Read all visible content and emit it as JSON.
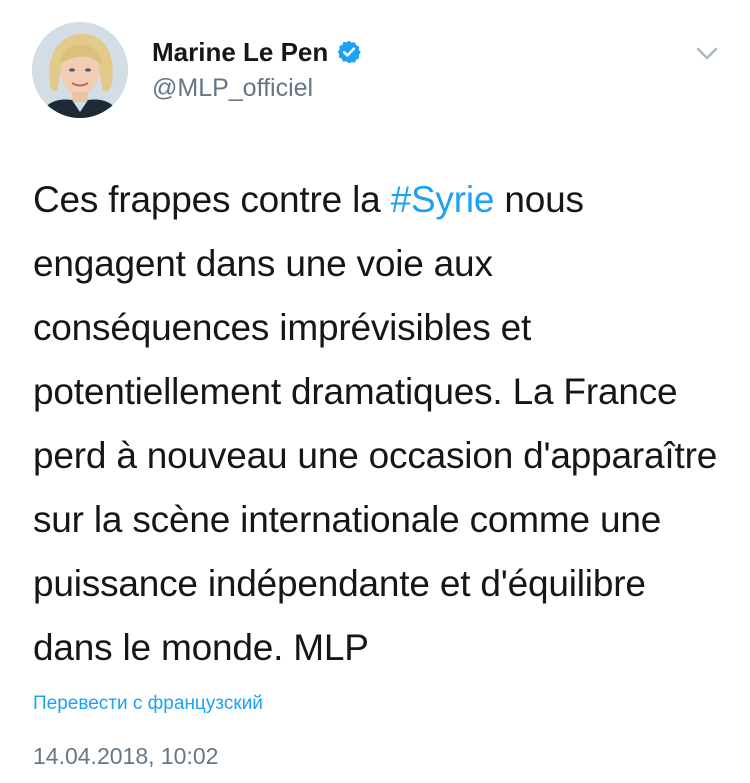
{
  "author": {
    "display_name": "Marine Le Pen",
    "handle": "@MLP_officiel",
    "verified": true
  },
  "icons": {
    "avatar": "profile-photo",
    "verified": "verified-badge-icon",
    "menu": "chevron-down-icon"
  },
  "tweet": {
    "text_before_hashtag": "Ces frappes contre la ",
    "hashtag": "#Syrie",
    "text_after_hashtag": " nous engagent dans une voie aux conséquences imprévisibles et potentiellement dramatiques. La France perd à nouveau une occasion d'apparaître sur la scène internationale comme une puissance indépendante et d'équilibre dans le monde. MLP"
  },
  "translate_link": "Перевести с французский",
  "timestamp": "14.04.2018, 10:02",
  "colors": {
    "link": "#1da1f2",
    "text": "#14171a",
    "muted": "#657786",
    "verified_badge": "#1da1f2"
  }
}
